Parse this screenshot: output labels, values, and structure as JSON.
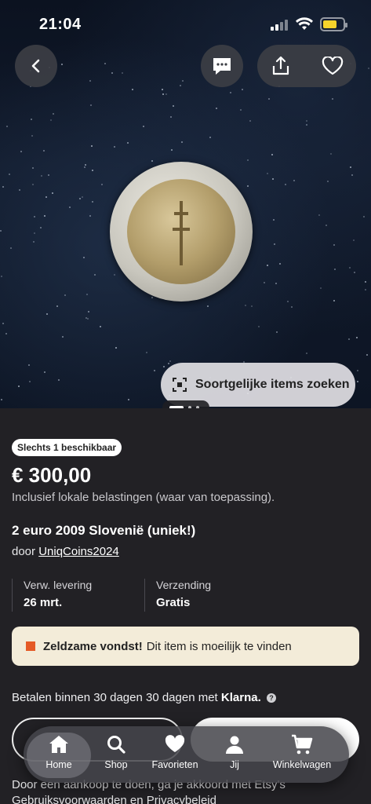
{
  "status": {
    "time": "21:04",
    "battery_color": "#f6d32b"
  },
  "top_actions": {
    "back_icon": "chevron-left-icon",
    "message_icon": "message-icon",
    "share_icon": "share-icon",
    "favorite_icon": "heart-icon"
  },
  "image": {
    "similar_button": "Soortgelijke items zoeken",
    "similar_icon": "visual-search-icon"
  },
  "listing": {
    "availability_badge": "Slechts 1 beschikbaar",
    "price": "€ 300,00",
    "tax_note": "Inclusief lokale belastingen (waar van toepassing).",
    "title": "2 euro 2009 Slovenië (uniek!)",
    "seller_prefix": "door",
    "seller_name": "UniqCoins2024",
    "delivery_label": "Verw. levering",
    "delivery_value": "26 mrt.",
    "shipping_label": "Verzending",
    "shipping_value": "Gratis",
    "rare_bold": "Zeldzame vondst!",
    "rare_text": "Dit item is moeilijk te vinden",
    "rare_accent": "#e55a26",
    "klarna_text": "Betalen binnen 30 dagen 30 dagen met",
    "klarna_brand": "Klarna.",
    "legal_line1": "Door een aankoop te doen, ga je akkoord met Etsy's",
    "legal_line2": "Gebruiksvoorwaarden en Privacybeleid"
  },
  "tabbar": {
    "items": [
      {
        "label": "Home",
        "icon": "home-icon",
        "active": true
      },
      {
        "label": "Shop",
        "icon": "search-icon",
        "active": false
      },
      {
        "label": "Favorieten",
        "icon": "heart-icon",
        "active": false
      },
      {
        "label": "Jij",
        "icon": "person-icon",
        "active": false
      },
      {
        "label": "Winkelwagen",
        "icon": "cart-icon",
        "active": false
      }
    ]
  }
}
